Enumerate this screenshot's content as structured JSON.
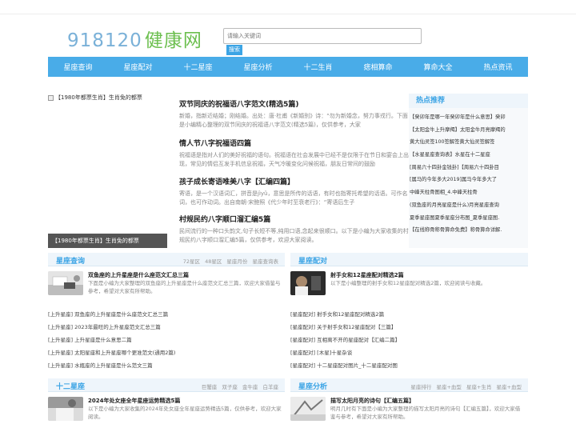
{
  "logo": {
    "digits": "918120",
    "cn": "健康网"
  },
  "search": {
    "placeholder": "请输入关键词",
    "button": "搜索"
  },
  "nav": [
    "星座查询",
    "星座配对",
    "十二星座",
    "星座分析",
    "十二生肖",
    "痣相算命",
    "算命大全",
    "热点资讯"
  ],
  "hero": {
    "alt_text": "【1980年都票生肖】生肖免的都票",
    "caption": "【1980年都票生肖】生肖免的都票"
  },
  "articles": [
    {
      "title": "双节同庆的祝福语八字范文(精选5篇)",
      "desc": "新婚，指新近结婚；刚结婚。出处：唐·杜甫《新婚别》诗：“勿为新婚念，努力事戎行。下面是小编精心整理的双节同庆的祝福语八字范文(精选5篇)，仅供参考，大家"
    },
    {
      "title": "情人节八字祝福语四篇",
      "desc": "祝福语是指对人们的美好祝福的语句。祝福语在社会发展中已经不是仅限于在节日和宴会上出现，常见的情侣互发手机信息祝福，天气冷暖变化问候祝福，朋友日常间的鼓励"
    },
    {
      "title": "孩子成长寄语唯美八字【汇编四篇】",
      "desc": "寄语，是一个汉语词汇，拼音是jìyǔ，意思是所传的话语，有时也指寄托希望的话语。可作名词，也可作动词。出自南朝·宋鲍照《代少年时至衰老行》：“寄语后生子"
    },
    {
      "title": "村规民约八字顺口溜汇编5篇",
      "desc": "民间流行的一种口头韵文,句子长短不等,纯用口语,念起来很顺口。以下是小编为大家收集的村规民约八字顺口溜汇编5篇，仅供参考，欢迎大家阅读。"
    }
  ],
  "hot": {
    "title": "热点推荐",
    "items": [
      "【癸卯年是哪一年癸卯年是什么意思】癸卯",
      "【太阳金牛上升摩羯】太阳金牛月亮摩羯的",
      "黄大仙灵签100签解签黄大仙灵签解签",
      "【水星星座查询表】水星在十二星座",
      "[周易六十四卦金钱卦]【周易六十四卦目",
      "[属马的今年多大2019]属马今年多大了",
      "中峰天柱骨图相_4.中峰天柱骨",
      "(双鱼座的月亮星座是什么)月亮星座查询",
      "夏季星座图夏季星座分布图_夏季星座图.",
      "【在线称骨称骨算命免费】称骨算命详解."
    ]
  },
  "sections": {
    "xzcx": {
      "title": "星座查询",
      "tags": [
        "72星区",
        "48星区",
        "星座月份",
        "星座查询表"
      ],
      "feature": {
        "title": "双鱼座的上升星座是什么座范文汇总三篇",
        "desc": "下面是小编为大家整理的双鱼座的上升星座是什么座范文汇总三篇，欢迎大家借鉴与参考，希望对大家有所帮助。"
      },
      "list": [
        {
          "pre": "[上升星座]",
          "text": "双鱼座的上升星座是什么座范文汇总三篇"
        },
        {
          "pre": "[上升星座]",
          "text": "2023年最旺的上升星座范文汇总三篇"
        },
        {
          "pre": "[上升星座]",
          "text": "上升星座是什么意思二篇"
        },
        {
          "pre": "[上升星座]",
          "text": "太阳星座和上升星座哪个更准范文(通用2篇)"
        },
        {
          "pre": "[上升星座]",
          "text": "水瓶座的上升星座是什么范文三篇"
        }
      ]
    },
    "xzpd": {
      "title": "星座配对",
      "tags": [],
      "feature": {
        "title": "射手女和12星座配对精选2篇",
        "desc": "以下是小编整理的射手女和12星座配对精选2篇，欢迎阅读与收藏。"
      },
      "list": [
        {
          "pre": "[星座配对]",
          "text": "射手女和12星座配对精选2篇"
        },
        {
          "pre": "[星座配对]",
          "text": "关于射手女和12星座配对【三篇】"
        },
        {
          "pre": "[星座配对]",
          "text": "互相离不开的星座配对【汇编二篇】"
        },
        {
          "pre": "[星座配对]",
          "text": "[木星]十星杂谈"
        },
        {
          "pre": "[星座配对]",
          "text": "十二星座配对图片_十二星座配对图"
        }
      ]
    },
    "sexz": {
      "title": "十二星座",
      "tags": [
        "巨蟹座",
        "双子座",
        "金牛座",
        "白羊座"
      ],
      "feature": {
        "title": "2024年处女座全年星座运势精选5篇",
        "desc": "以下是小编为大家收集的2024年处女座全年星座运势精选5篇，仅供参考，欢迎大家阅读。"
      }
    },
    "xzfx": {
      "title": "星座分析",
      "tags": [
        "星座排行",
        "星座+血型",
        "星座+生肖",
        "星座+血型"
      ],
      "feature": {
        "title": "描写太阳月亮的诗句【汇编五篇】",
        "desc": "明月几时有下面是小编为大家整理的描写太阳月亮的诗句【汇编五篇】，欢迎大家借鉴与参考，希望对大家有所帮助。"
      }
    }
  }
}
